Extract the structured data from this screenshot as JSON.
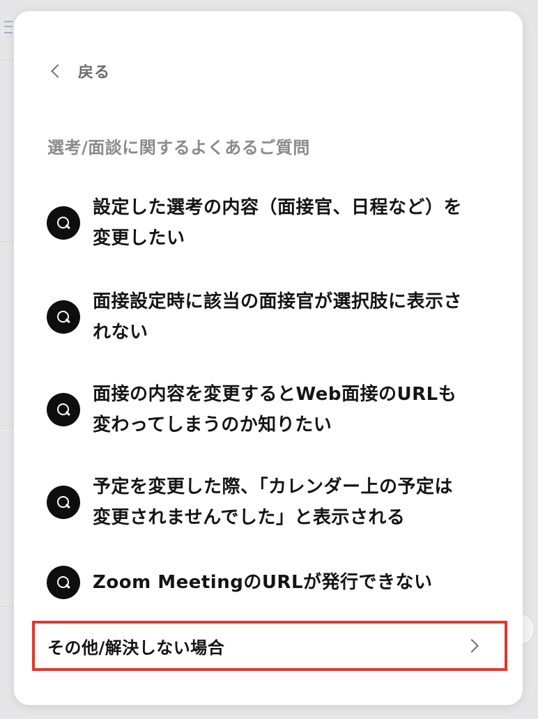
{
  "nav": {
    "back_label": "戻る"
  },
  "section": {
    "title": "選考/面談に関するよくあるご質問"
  },
  "faq": [
    {
      "lines": [
        "設定した選考の内容（面接官、日程など）を",
        "変更したい"
      ]
    },
    {
      "lines": [
        "面接設定時に該当の面接官が選択肢に表示さ",
        "れない"
      ]
    },
    {
      "lines": [
        "面接の内容を変更するとWeb面接のURLも",
        "変わってしまうのか知りたい"
      ]
    },
    {
      "lines": [
        "予定を変更した際、「カレンダー上の予定は",
        "変更されませんでした」と表示される"
      ]
    },
    {
      "lines": [
        "Zoom MeetingのURLが発行できない"
      ]
    }
  ],
  "other": {
    "label": "その他/解決しない場合"
  },
  "icons": {
    "back": "chevron-left-icon",
    "question": "q-icon",
    "forward": "chevron-right-icon"
  },
  "colors": {
    "highlight_border": "#e2372b",
    "icon_bg": "#0e0e0e",
    "section_title": "#8a8a8f"
  }
}
